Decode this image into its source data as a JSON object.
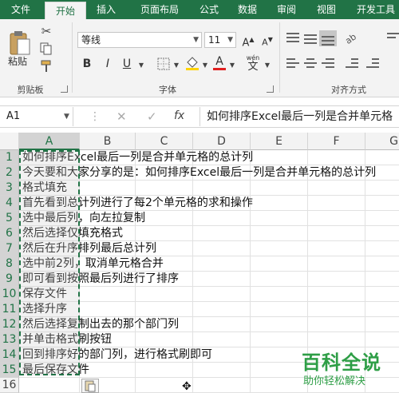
{
  "ribbon_tabs": [
    "文件",
    "开始",
    "插入",
    "页面布局",
    "公式",
    "数据",
    "审阅",
    "视图",
    "开发工具"
  ],
  "clipboard": {
    "paste_label": "粘贴",
    "group_label": "剪贴板"
  },
  "font": {
    "name": "等线",
    "size": "11",
    "bold": "B",
    "italic": "I",
    "underline": "U",
    "wen": "wén",
    "wen_char": "文",
    "group_label": "字体",
    "grow": "A",
    "shrink": "A"
  },
  "alignment": {
    "group_label": "对齐方式"
  },
  "formula_bar": {
    "name_box": "A1",
    "fx": "fx",
    "cancel": "✕",
    "enter": "✓",
    "content": "如何排序Excel最后一列是合并单元格"
  },
  "columns": [
    "A",
    "B",
    "C",
    "D",
    "E",
    "F",
    "G"
  ],
  "rows": [
    {
      "num": "1",
      "text": "如何排序Excel最后一列是合并单元格的总计列"
    },
    {
      "num": "2",
      "text": "今天要和大家分享的是：如何排序Excel最后一列是合并单元格的总计列"
    },
    {
      "num": "3",
      "text": "格式填充"
    },
    {
      "num": "4",
      "text": "首先看到总计列进行了每2个单元格的求和操作"
    },
    {
      "num": "5",
      "text": "选中最后列，向左拉复制"
    },
    {
      "num": "6",
      "text": "然后选择仅填充格式"
    },
    {
      "num": "7",
      "text": "然后在升序排列最后总计列"
    },
    {
      "num": "8",
      "text": "选中前2列，取消单元格合并"
    },
    {
      "num": "9",
      "text": "即可看到按照最后列进行了排序"
    },
    {
      "num": "10",
      "text": "保存文件"
    },
    {
      "num": "11",
      "text": "选择升序"
    },
    {
      "num": "12",
      "text": "然后选择复制出去的那个部门列"
    },
    {
      "num": "13",
      "text": "并单击格式刷按钮"
    },
    {
      "num": "14",
      "text": "回到排序好的部门列，进行格式刷即可"
    },
    {
      "num": "15",
      "text": "最后保存文件"
    },
    {
      "num": "16",
      "text": ""
    }
  ],
  "watermark": {
    "title": "百科全说",
    "subtitle": "助你轻松解决"
  },
  "colors": {
    "excel_green": "#217346",
    "watermark_green": "#2e9e46"
  }
}
